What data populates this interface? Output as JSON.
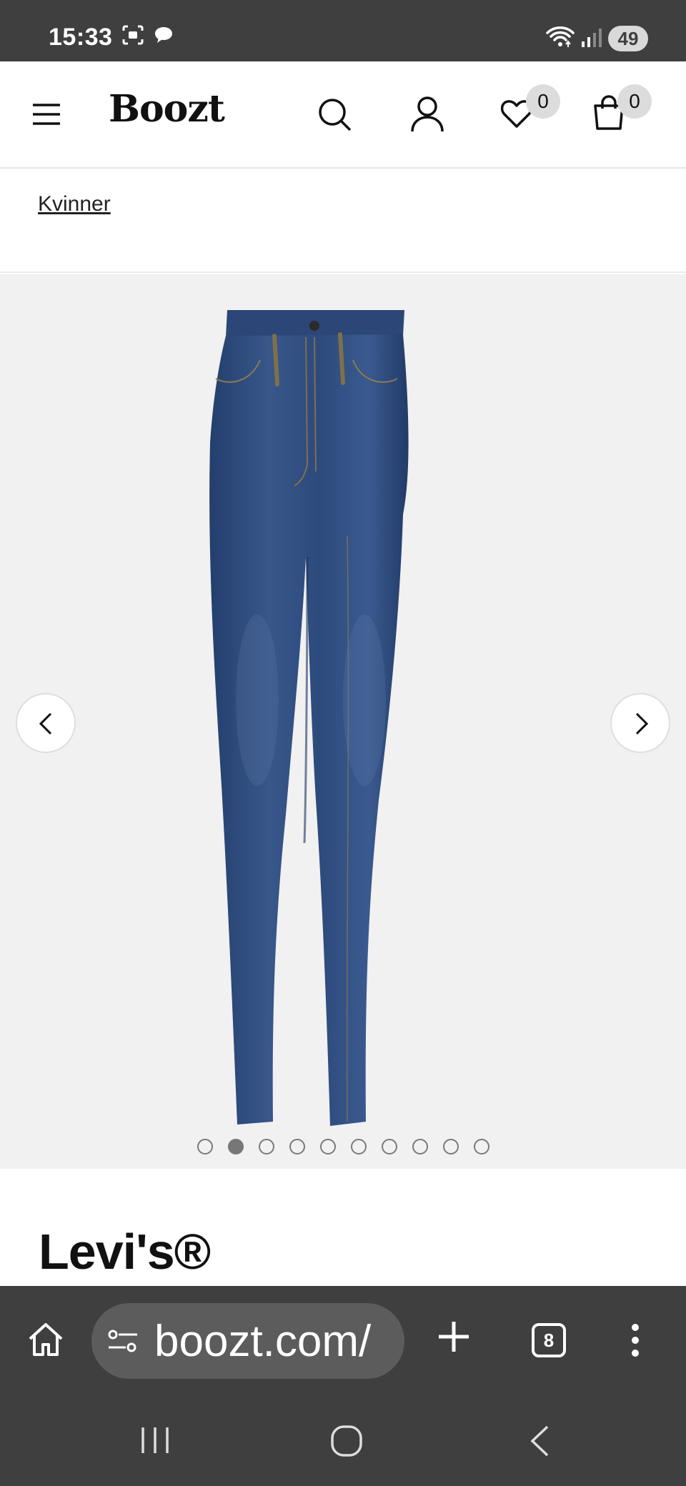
{
  "status_bar": {
    "time": "15:33",
    "battery": "49",
    "icons": [
      "screenshot-icon",
      "chat-bubble-icon",
      "wifi-icon",
      "signal-icon",
      "battery-icon"
    ]
  },
  "header": {
    "logo": "Boozt",
    "wishlist_count": "0",
    "cart_count": "0",
    "icons": [
      "menu-icon",
      "search-icon",
      "account-icon",
      "heart-icon",
      "shopping-bag-icon"
    ]
  },
  "breadcrumb": {
    "label": "Kvinner"
  },
  "gallery": {
    "image": "jeans-product-photo",
    "total_images": 10,
    "active_index": 1,
    "background": "#f1f1f1",
    "denim_color": "#2f4b7d"
  },
  "product": {
    "brand": "Levi's®"
  },
  "browser": {
    "url": "boozt.com/",
    "tab_count": "8"
  },
  "colors": {
    "system_bar": "#3f3f3f",
    "url_pill": "#5c5c5c",
    "badge": "#dcdcdc"
  }
}
